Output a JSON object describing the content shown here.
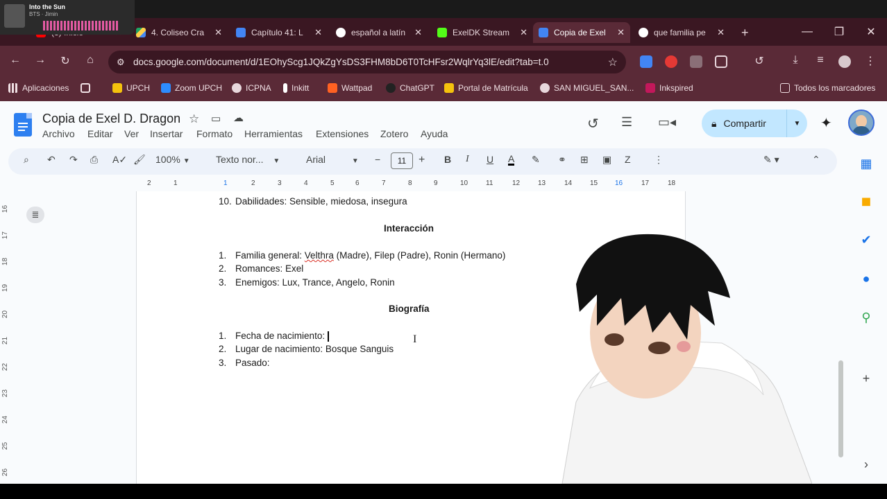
{
  "media": {
    "title": "Into the Sun",
    "artist": "BTS · Jimin"
  },
  "tabs": [
    {
      "label": "(3) Inicio",
      "icon": "youtube-icon"
    },
    {
      "label": "4. Coliseo Cra",
      "icon": "drive-icon"
    },
    {
      "label": "Capítulo 41: L",
      "icon": "docs-icon"
    },
    {
      "label": "español a latín",
      "icon": "google-icon"
    },
    {
      "label": "ExelDK Stream",
      "icon": "kick-icon"
    },
    {
      "label": "Copia de Exel",
      "icon": "docs-icon"
    },
    {
      "label": "que familia pe",
      "icon": "google-icon"
    }
  ],
  "address": {
    "url": "docs.google.com/document/d/1EOhyScg1JQkZgYsDS3FHM8bD6T0TcHFsr2WqlrYq3lE/edit?tab=t.0"
  },
  "bookmarks": [
    "Aplicaciones",
    "UPCH",
    "Zoom UPCH",
    "ICPNA",
    "Inkitt",
    "Wattpad",
    "ChatGPT",
    "Portal de Matrícula",
    "SAN MIGUEL_SAN...",
    "Inkspired",
    "Todos los marcadores"
  ],
  "doc": {
    "title": "Copia de Exel D. Dragon",
    "menus": [
      "Archivo",
      "Editar",
      "Ver",
      "Insertar",
      "Formato",
      "Herramientas",
      "Extensiones",
      "Zotero",
      "Ayuda"
    ],
    "share_label": "Compartir"
  },
  "toolbar": {
    "zoom": "100%",
    "style": "Texto nor...",
    "font": "Arial",
    "font_size": "11"
  },
  "ruler": [
    "2",
    "1",
    "1",
    "2",
    "3",
    "4",
    "5",
    "6",
    "7",
    "8",
    "9",
    "10",
    "11",
    "12",
    "13",
    "14",
    "15",
    "16",
    "17",
    "18"
  ],
  "vruler": [
    "16",
    "17",
    "18",
    "19",
    "20",
    "21",
    "22",
    "23",
    "24",
    "25",
    "26"
  ],
  "content": {
    "top_item": {
      "num": "10.",
      "text": "Dabilidades: Sensible, miedosa, insegura"
    },
    "section1": "Interacción",
    "list1": [
      {
        "num": "1.",
        "pre": "Familia general: ",
        "spell": "Velthra",
        "post": " (Madre), Filep (Padre), Ronin (Hermano)"
      },
      {
        "num": "2.",
        "pre": "Romances: Exel",
        "spell": "",
        "post": ""
      },
      {
        "num": "3.",
        "pre": "Enemigos: Lux, Trance, Angelo, Ronin",
        "spell": "",
        "post": ""
      }
    ],
    "section2": "Biografía",
    "list2": [
      {
        "num": "1.",
        "text": "Fecha de nacimiento:"
      },
      {
        "num": "2.",
        "text": "Lugar de nacimiento: Bosque Sanguis"
      },
      {
        "num": "3.",
        "text": "Pasado:"
      }
    ]
  },
  "colors": {
    "chrome_dark": "#3a1722",
    "chrome": "#5a2a37",
    "accent": "#c2e7ff",
    "docs_blue": "#2d7ff0"
  }
}
